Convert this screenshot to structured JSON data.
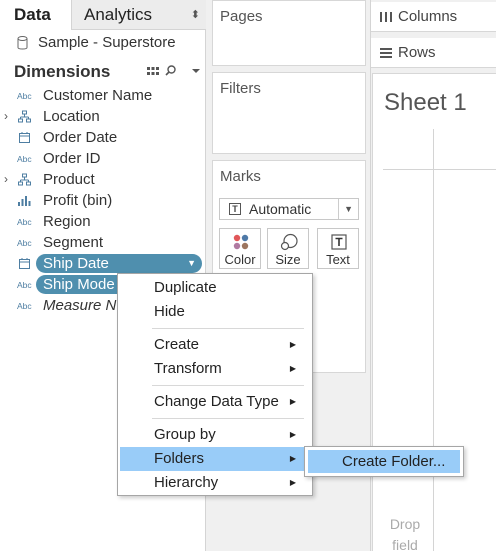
{
  "data_pane": {
    "tabs": {
      "data": "Data",
      "analytics": "Analytics"
    },
    "data_source": "Sample - Superstore",
    "dimensions_title": "Dimensions",
    "fields": [
      {
        "name": "Customer Name",
        "icon": "abc-string-icon"
      },
      {
        "name": "Location",
        "icon": "hierarchy-icon",
        "expandable": true
      },
      {
        "name": "Order Date",
        "icon": "calendar-icon"
      },
      {
        "name": "Order ID",
        "icon": "abc-string-icon"
      },
      {
        "name": "Product",
        "icon": "hierarchy-icon",
        "expandable": true
      },
      {
        "name": "Profit (bin)",
        "icon": "bin-histogram-icon"
      },
      {
        "name": "Region",
        "icon": "abc-string-icon"
      },
      {
        "name": "Segment",
        "icon": "abc-string-icon"
      },
      {
        "name": "Ship Date",
        "icon": "calendar-icon",
        "selected": true
      },
      {
        "name": "Ship Mode",
        "icon": "abc-string-icon",
        "selected": true
      },
      {
        "name": "Measure N",
        "icon": "abc-string-icon",
        "italic": true
      }
    ]
  },
  "shelves": {
    "pages": "Pages",
    "filters": "Filters",
    "marks": "Marks",
    "mark_type": "Automatic",
    "mark_buttons": {
      "color": "Color",
      "size": "Size",
      "text": "Text"
    },
    "columns": "Columns",
    "rows": "Rows"
  },
  "view": {
    "sheet_title": "Sheet 1",
    "drop_hint": "Drop field"
  },
  "context_menu": {
    "items": [
      {
        "label": "Duplicate"
      },
      {
        "label": "Hide"
      },
      {
        "label": "Create",
        "submenu": true
      },
      {
        "label": "Transform",
        "submenu": true
      },
      {
        "label": "Change Data Type",
        "submenu": true
      },
      {
        "label": "Group by",
        "submenu": true
      },
      {
        "label": "Folders",
        "submenu": true,
        "highlighted": true
      },
      {
        "label": "Hierarchy",
        "submenu": true
      }
    ],
    "submenu": {
      "label": "Create Folder..."
    }
  },
  "colors": {
    "selection_pill": "#4f8fae",
    "menu_highlight": "#99ccf8",
    "field_icon": "#4e7ea2"
  }
}
